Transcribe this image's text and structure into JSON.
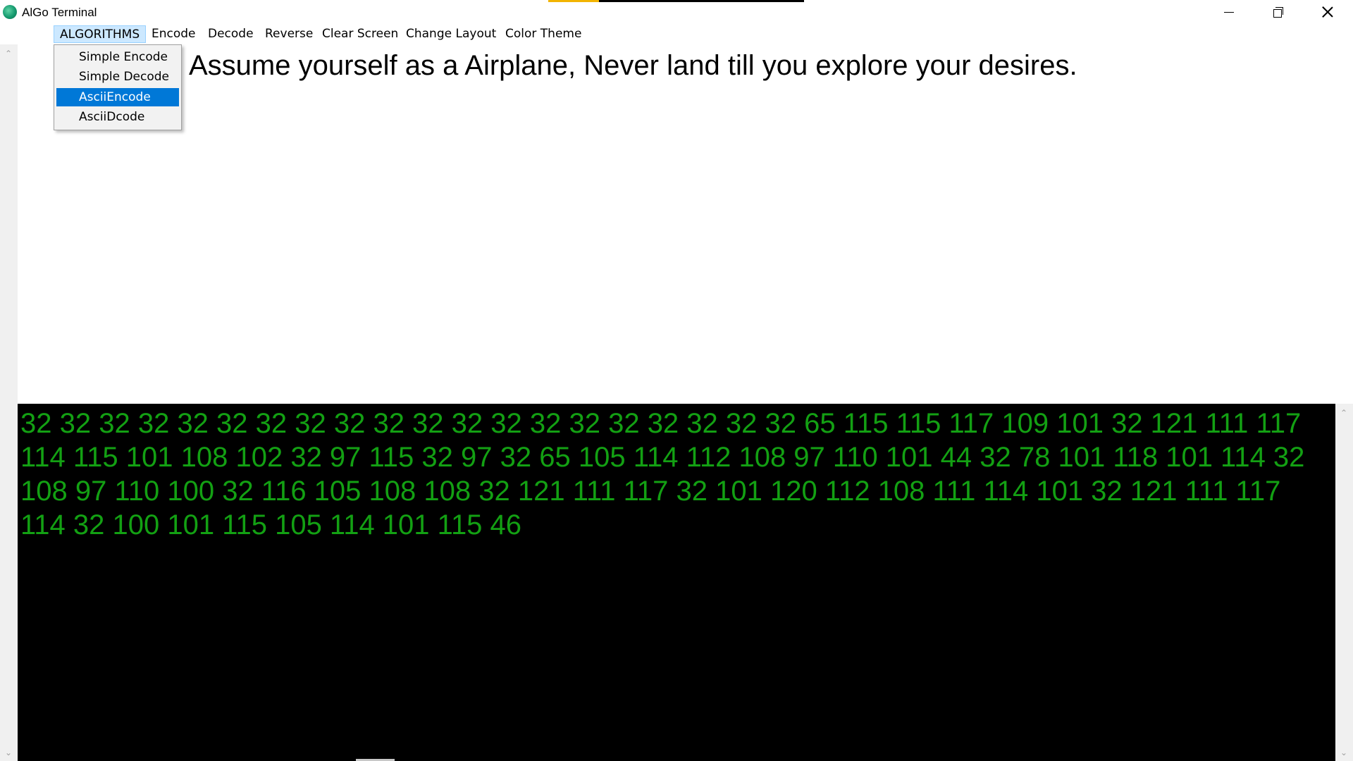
{
  "window": {
    "title": "AlGo Terminal",
    "icon": "app-logo-icon"
  },
  "menubar": {
    "items": [
      "ALGORITHMS",
      "Encode",
      "Decode",
      "Reverse",
      "Clear Screen",
      "Change Layout",
      "Color Theme"
    ],
    "active": "ALGORITHMS"
  },
  "dropdown": {
    "items": [
      "Simple Encode",
      "Simple Decode",
      "AsciiEncode",
      "AsciiDcode"
    ],
    "selected": "AsciiEncode"
  },
  "input": {
    "text": "Assume yourself as a Airplane, Never land till you explore your desires."
  },
  "output": {
    "text": "32 32 32 32 32 32 32 32 32 32 32 32 32 32 32 32 32 32 32 32 65 115 115 117 109 101 32 121 111 117 114 115 101 108 102 32 97 115 32 97 32 65 105 114 112 108 97 110 101 44 32 78 101 118 101 114 32 108 97 110 100 32 116 105 108 108 32 121 111 117 32 101 120 112 108 111 114 101 32 121 111 117 114 32 100 101 115 105 114 101 115 46",
    "color": "#13a013",
    "background": "#000000"
  },
  "colors": {
    "menu_active_bg": "#cce8ff",
    "dropdown_selected_bg": "#0078d7"
  }
}
